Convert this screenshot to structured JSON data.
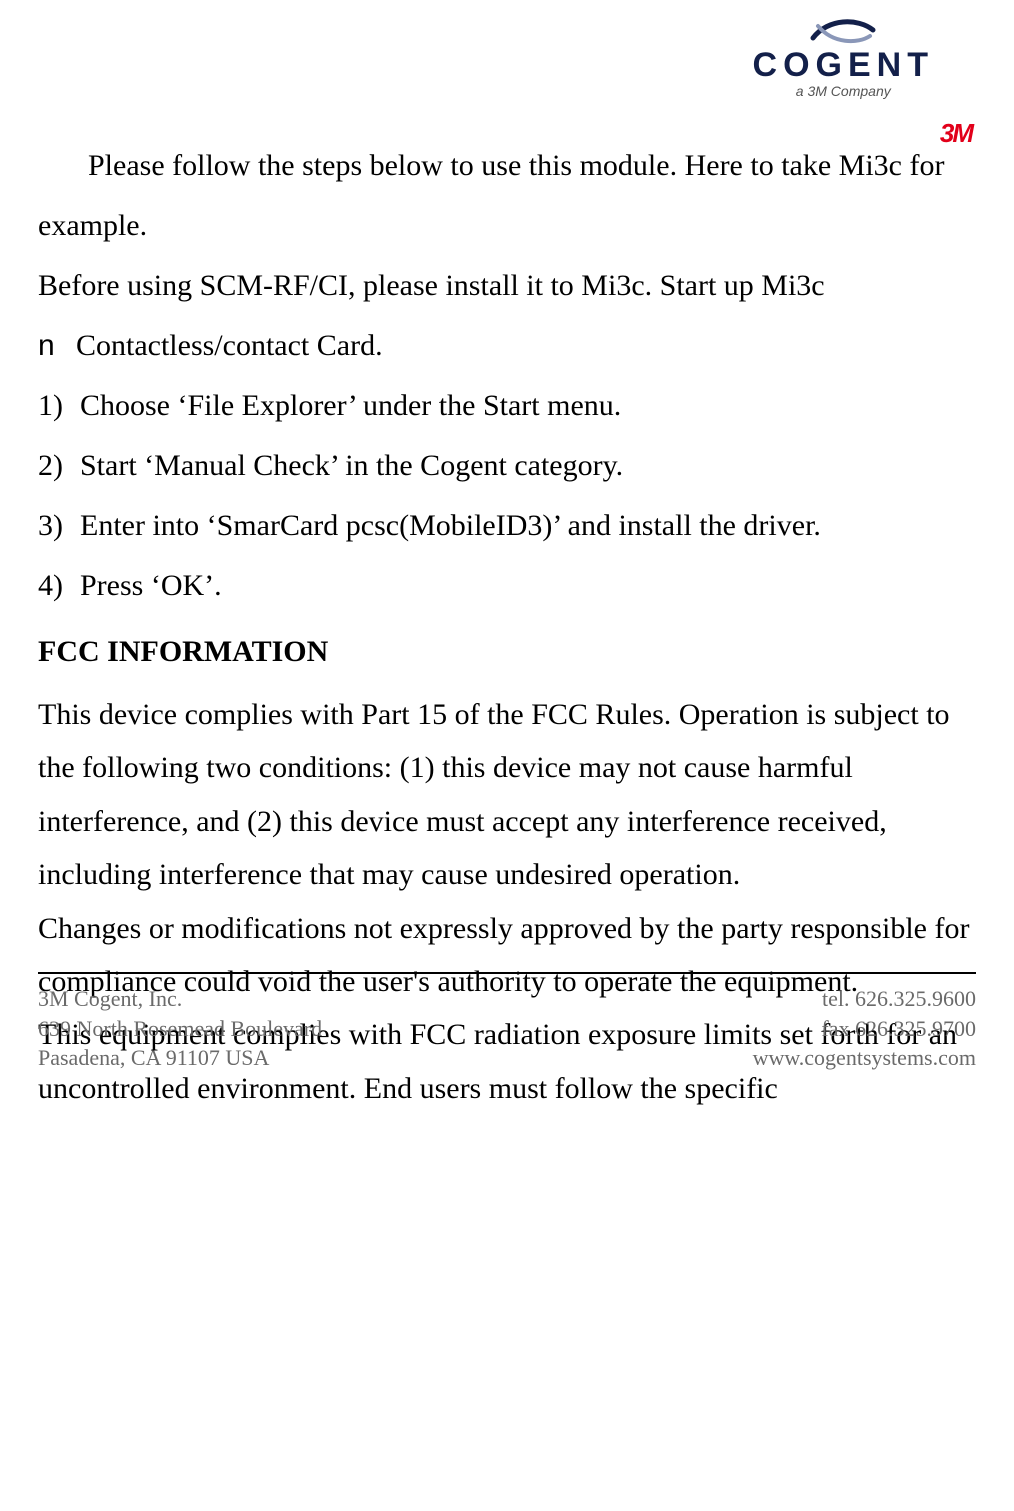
{
  "logo": {
    "brand": "COGENT",
    "subline": "a 3M Company",
    "mmm": "3M"
  },
  "body": {
    "intro": "Please follow the steps below to use this module. Here to take Mi3c for example.",
    "before": "Before using SCM-RF/CI, please install it to Mi3c. Start up Mi3c",
    "bullet_mark": "n",
    "bullet_text": "Contactless/contact Card.",
    "steps": [
      {
        "num": "1)",
        "text": "Choose ‘File Explorer’ under the Start menu."
      },
      {
        "num": "2)",
        "text": "Start ‘Manual Check’ in the Cogent category."
      },
      {
        "num": "3)",
        "text": "Enter into ‘SmarCard pcsc(MobileID3)’ and install the driver."
      },
      {
        "num": "4)",
        "text": "Press ‘OK’."
      }
    ],
    "fcc_heading": "FCC INFORMATION",
    "fcc_p1": "This device complies with Part 15 of the FCC Rules. Operation is subject to the following two conditions: (1) this device may not cause harmful interference, and (2) this device must accept any interference received, including interference that may cause undesired operation.",
    "fcc_p2": "Changes or modifications not expressly approved by the party responsible for compliance could void the user's authority to operate the equipment.",
    "fcc_p3": "This equipment complies with FCC radiation exposure limits set forth for an uncontrolled environment. End users must follow the specific"
  },
  "footer": {
    "left": {
      "l1": "3M Cogent, Inc.",
      "l2": "639 North Rosemead Boulevard",
      "l3": "Pasadena, CA 91107 USA"
    },
    "right": {
      "l1": "tel. 626.325.9600",
      "l2": "fax 626.325.9700",
      "l3": "www.cogentsystems.com"
    }
  }
}
